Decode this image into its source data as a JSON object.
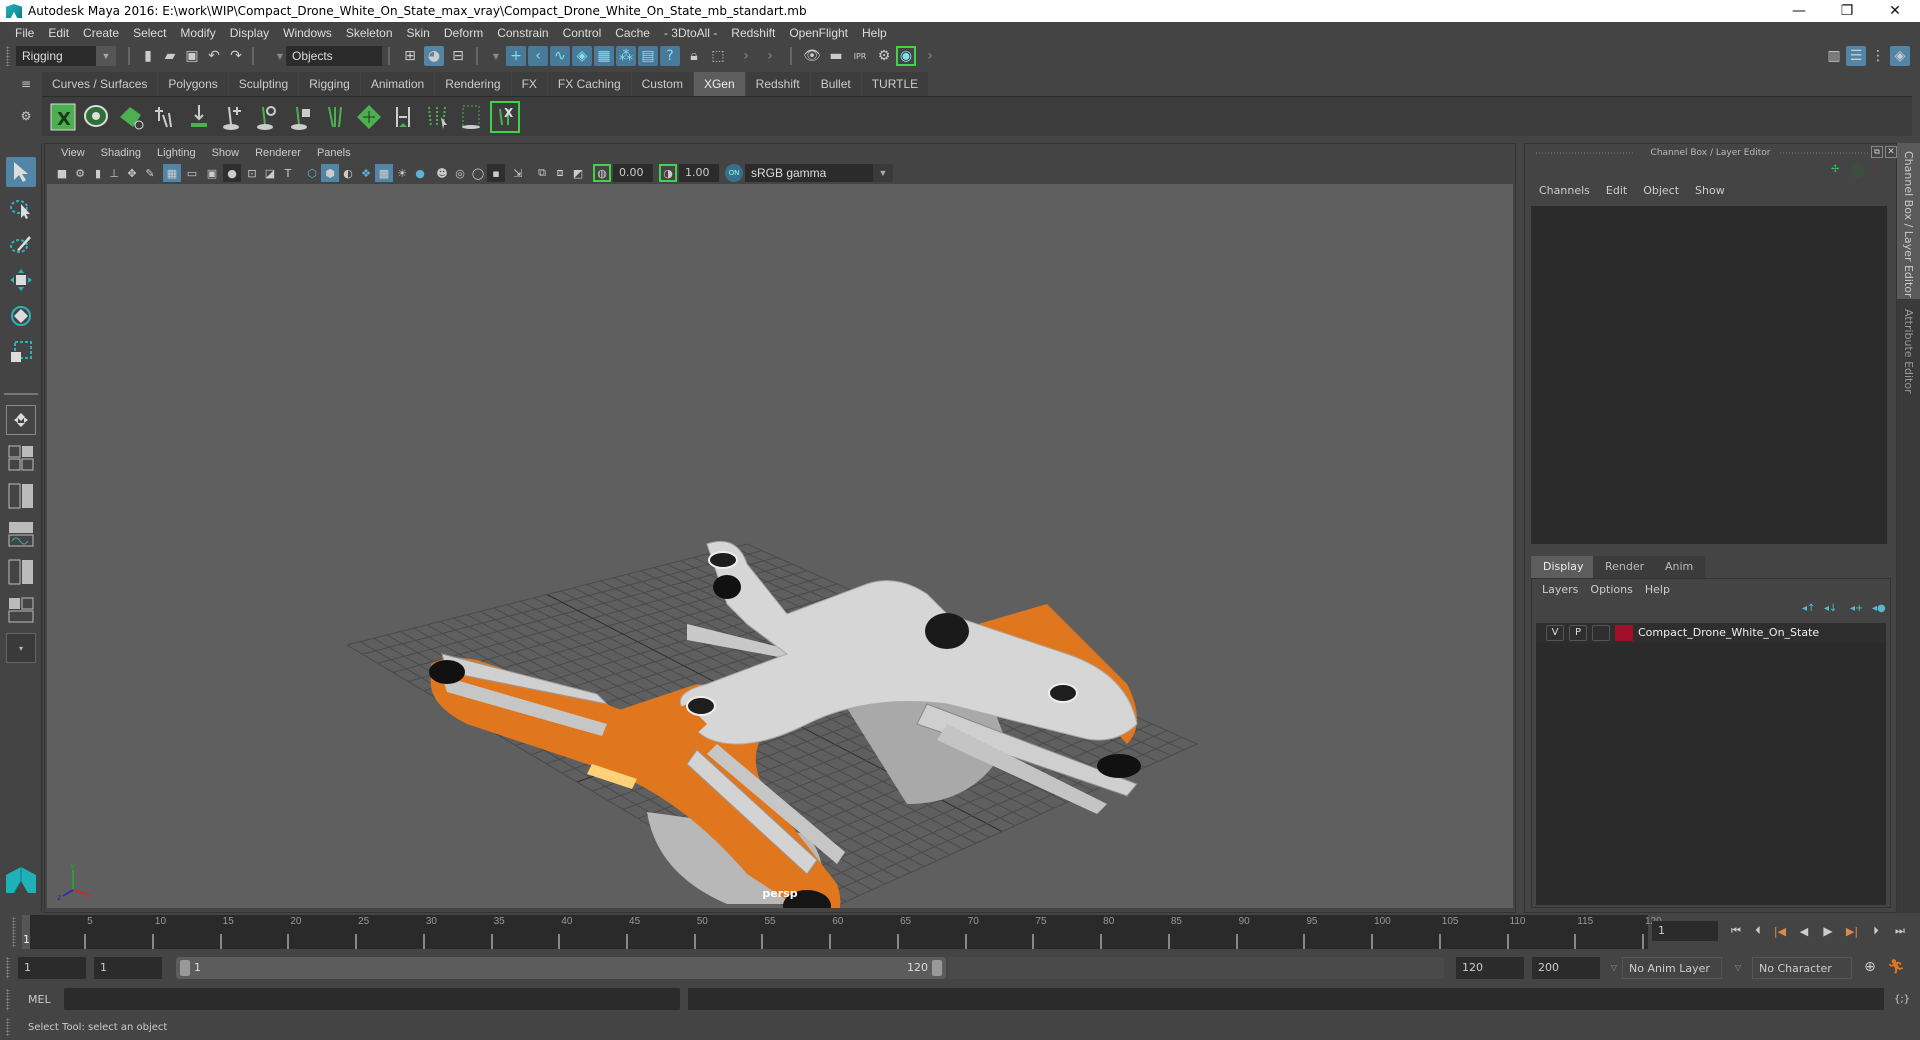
{
  "window": {
    "title": "Autodesk Maya 2016: E:\\work\\WIP\\Compact_Drone_White_On_State_max_vray\\Compact_Drone_White_On_State_mb_standart.mb",
    "minimize": "—",
    "restore": "❐",
    "close": "✕"
  },
  "menubar": [
    "File",
    "Edit",
    "Create",
    "Select",
    "Modify",
    "Display",
    "Windows",
    "Skeleton",
    "Skin",
    "Deform",
    "Constrain",
    "Control",
    "Cache",
    "- 3DtoAll -",
    "Redshift",
    "OpenFlight",
    "Help"
  ],
  "statusline": {
    "menuset": "Rigging",
    "selection_mode": "Objects"
  },
  "shelf": {
    "tabs": [
      "Curves / Surfaces",
      "Polygons",
      "Sculpting",
      "Rigging",
      "Animation",
      "Rendering",
      "FX",
      "FX Caching",
      "Custom",
      "XGen",
      "Redshift",
      "Bullet",
      "TURTLE"
    ],
    "active_tab": "XGen"
  },
  "viewport": {
    "menu": [
      "View",
      "Shading",
      "Lighting",
      "Show",
      "Renderer",
      "Panels"
    ],
    "exposure": "0.00",
    "gamma": "1.00",
    "color_space": "sRGB gamma",
    "camera_label": "persp",
    "axis": {
      "x": "x",
      "y": "y",
      "z": "z"
    }
  },
  "channel_box": {
    "title": "Channel Box / Layer Editor",
    "menu": [
      "Channels",
      "Edit",
      "Object",
      "Show"
    ]
  },
  "layer_editor": {
    "tabs": [
      "Display",
      "Render",
      "Anim"
    ],
    "active_tab": "Display",
    "menu": [
      "Layers",
      "Options",
      "Help"
    ],
    "layers": [
      {
        "visible": "V",
        "playback": "P",
        "name": "Compact_Drone_White_On_State",
        "color": "#a0102a"
      }
    ]
  },
  "side_tabs": [
    "Channel Box / Layer Editor",
    "Attribute Editor"
  ],
  "timeline": {
    "ticks": [
      5,
      10,
      15,
      20,
      25,
      30,
      35,
      40,
      45,
      50,
      55,
      60,
      65,
      70,
      75,
      80,
      85,
      90,
      95,
      100,
      105,
      110,
      115,
      120
    ],
    "current_frame_marker": "1",
    "current_frame": "1",
    "start": 1,
    "end": 120
  },
  "range": {
    "start_time": "1",
    "playback_start": "1",
    "slider_start": "1",
    "slider_end": "120",
    "playback_end": "120",
    "end_time": "200",
    "anim_layer": "No Anim Layer",
    "character_set": "No Character Set"
  },
  "command_line": {
    "language": "MEL"
  },
  "help_line": "Select Tool: select an object"
}
